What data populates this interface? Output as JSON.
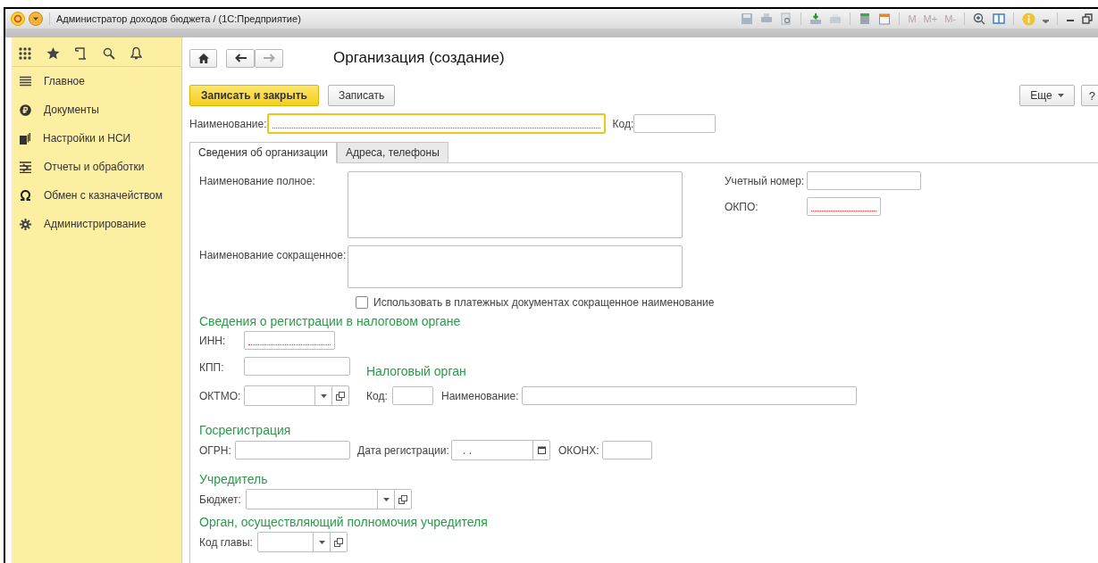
{
  "window": {
    "title": "Администратор доходов бюджета /  (1С:Предприятие)"
  },
  "toolbar": {
    "memory_buttons": [
      "M",
      "M+",
      "M-"
    ]
  },
  "sidebar": {
    "items": [
      {
        "label": "Главное"
      },
      {
        "label": "Документы"
      },
      {
        "label": "Настройки и НСИ"
      },
      {
        "label": "Отчеты и обработки"
      },
      {
        "label": "Обмен с казначейством"
      },
      {
        "label": "Администрирование"
      }
    ]
  },
  "form": {
    "title": "Организация (создание)",
    "buttons": [
      {
        "label": "Записать и закрыть",
        "kind": "primary"
      },
      {
        "label": "Записать",
        "kind": "default"
      }
    ],
    "more_button": "Еще",
    "help_button": "?",
    "name_field": {
      "label": "Наименование:",
      "required": true
    },
    "code_field": {
      "label": "Код:",
      "required": false
    },
    "tabs": [
      {
        "label": "Сведения об организации",
        "selected": true
      },
      {
        "label": "Адреса, телефоны",
        "selected": false
      }
    ],
    "full_name": {
      "label": "Наименование полное:"
    },
    "short_name": {
      "label": "Наименование сокращенное:"
    },
    "account_number": {
      "label": "Учетный номер:",
      "required": false
    },
    "okpo": {
      "label": "ОКПО:",
      "required": true
    },
    "use_short_name": {
      "label": "Использовать в платежных документах сокращенное наименование",
      "checked": false
    },
    "tax_registration": {
      "heading": "Сведения о регистрации в налоговом органе",
      "inn": {
        "label": "ИНН:",
        "required": true
      },
      "kpp": {
        "label": "КПП:",
        "required": false
      },
      "oktmo": {
        "label": "ОКТМО:"
      }
    },
    "tax_authority": {
      "heading": "Налоговый орган",
      "code": {
        "label": "Код:"
      },
      "name": {
        "label": "Наименование:"
      }
    },
    "state_registration": {
      "heading": "Госрегистрация",
      "ogrn": {
        "label": "ОГРН:"
      },
      "registration_date": {
        "label": "Дата регистрации:",
        "value": ". ."
      },
      "okonh": {
        "label": "ОКОНХ:"
      }
    },
    "founder": {
      "heading": "Учредитель",
      "budget": {
        "label": "Бюджет:"
      }
    },
    "founder_authority": {
      "heading": "Орган, осуществляющий полномочия учредителя",
      "head_code": {
        "label": "Код главы:"
      }
    }
  }
}
